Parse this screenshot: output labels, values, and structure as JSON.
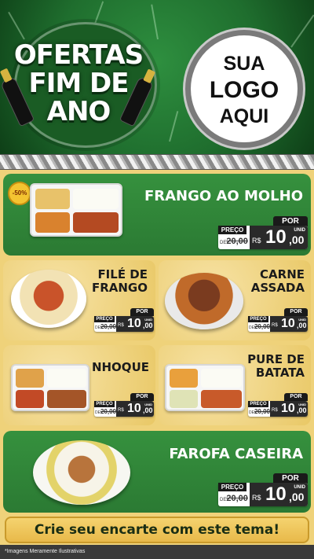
{
  "header": {
    "title_lines": [
      "OFERTAS",
      "FIM DE",
      "ANO"
    ],
    "logo_lines": [
      "SUA",
      "LOGO",
      "AQUI"
    ]
  },
  "labels": {
    "price_prefix": "PREÇO",
    "per": "POR",
    "old_prefix": "DE",
    "unit": "UNID",
    "currency": "R$"
  },
  "items": [
    {
      "name": "FRANGO AO MOLHO",
      "old_price": "20,00",
      "price_int": "10",
      "price_dec": ",00",
      "badge": "-50%"
    },
    {
      "name": "FILÉ DE FRANGO",
      "old_price": "20,00",
      "price_int": "10",
      "price_dec": ",00"
    },
    {
      "name": "CARNE ASSADA",
      "old_price": "20,00",
      "price_int": "10",
      "price_dec": ",00"
    },
    {
      "name": "NHOQUE",
      "old_price": "20,00",
      "price_int": "10",
      "price_dec": ",00"
    },
    {
      "name": "PURE DE BATATA",
      "old_price": "20,00",
      "price_int": "10",
      "price_dec": ",00"
    },
    {
      "name": "FAROFA CASEIRA",
      "old_price": "20,00",
      "price_int": "10",
      "price_dec": ",00"
    }
  ],
  "cta": "Crie seu encarte com este tema!",
  "footnote": "*Imagens Meramente Ilustrativas",
  "colors": {
    "green": "#2b7a33",
    "beige": "#efd27a",
    "dark": "#1a1a1a"
  }
}
